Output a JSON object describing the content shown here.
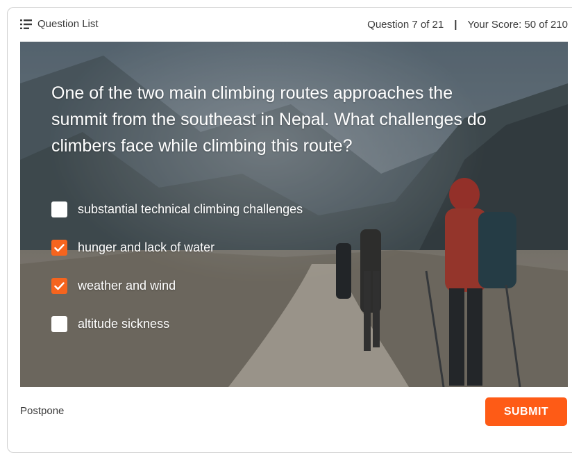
{
  "header": {
    "question_list_label": "Question List",
    "question_counter": "Question 7 of 21",
    "separator": "|",
    "score_text": "Your Score: 50 of 210"
  },
  "question": {
    "text": "One of the two main climbing routes approaches the summit from the southeast in Nepal. What challenges do climbers face while climbing this route?",
    "options": [
      {
        "label": "substantial technical climbing challenges",
        "checked": false
      },
      {
        "label": "hunger and lack of water",
        "checked": true
      },
      {
        "label": "weather and wind",
        "checked": true
      },
      {
        "label": "altitude sickness",
        "checked": false
      }
    ]
  },
  "footer": {
    "postpone_label": "Postpone",
    "submit_label": "SUBMIT"
  },
  "colors": {
    "accent": "#fe5b16",
    "checkbox_checked": "#f5641e"
  },
  "icons": {
    "question_list": "list-icon",
    "checkmark": "checkmark-icon"
  }
}
